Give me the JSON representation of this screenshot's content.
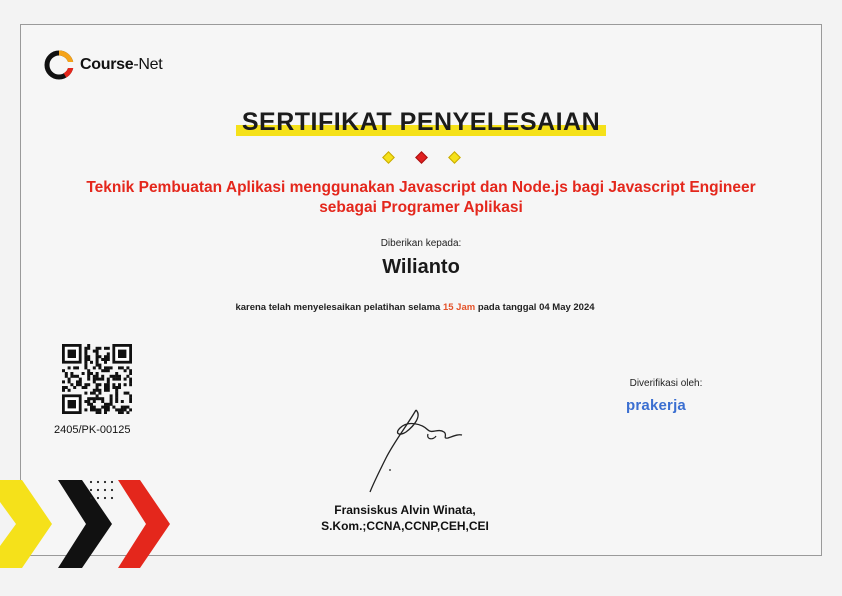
{
  "brand": {
    "name_bold": "Course",
    "name_light": "-Net"
  },
  "title": "SERTIFIKAT PENYELESAIAN",
  "course": {
    "line1": "Teknik Pembuatan Aplikasi menggunakan Javascript dan Node.js bagi Javascript Engineer",
    "line2": "sebagai Programer Aplikasi"
  },
  "given_label": "Diberikan kepada:",
  "recipient": "Wilianto",
  "reason": {
    "prefix": "karena telah menyelesaikan pelatihan selama ",
    "duration": "15 Jam",
    "suffix": " pada tanggal 04 May 2024"
  },
  "certificate_number": "2405/PK-00125",
  "verified_label": "Diverifikasi oleh:",
  "verifier": "prakerja",
  "signer": {
    "name": "Fransiskus Alvin Winata,",
    "credentials": "S.Kom.;CCNA,CCNP,CEH,CEI"
  },
  "colors": {
    "accent_red": "#e4271c",
    "highlight_yellow": "#f5e11a",
    "dark": "#111111",
    "prakerja_blue": "#3b6fd1",
    "prakerja_orange": "#f08a24"
  },
  "icons": [
    "course-net-logo-icon",
    "qr-code-icon",
    "signature-image",
    "chevron-decoration-icon"
  ]
}
